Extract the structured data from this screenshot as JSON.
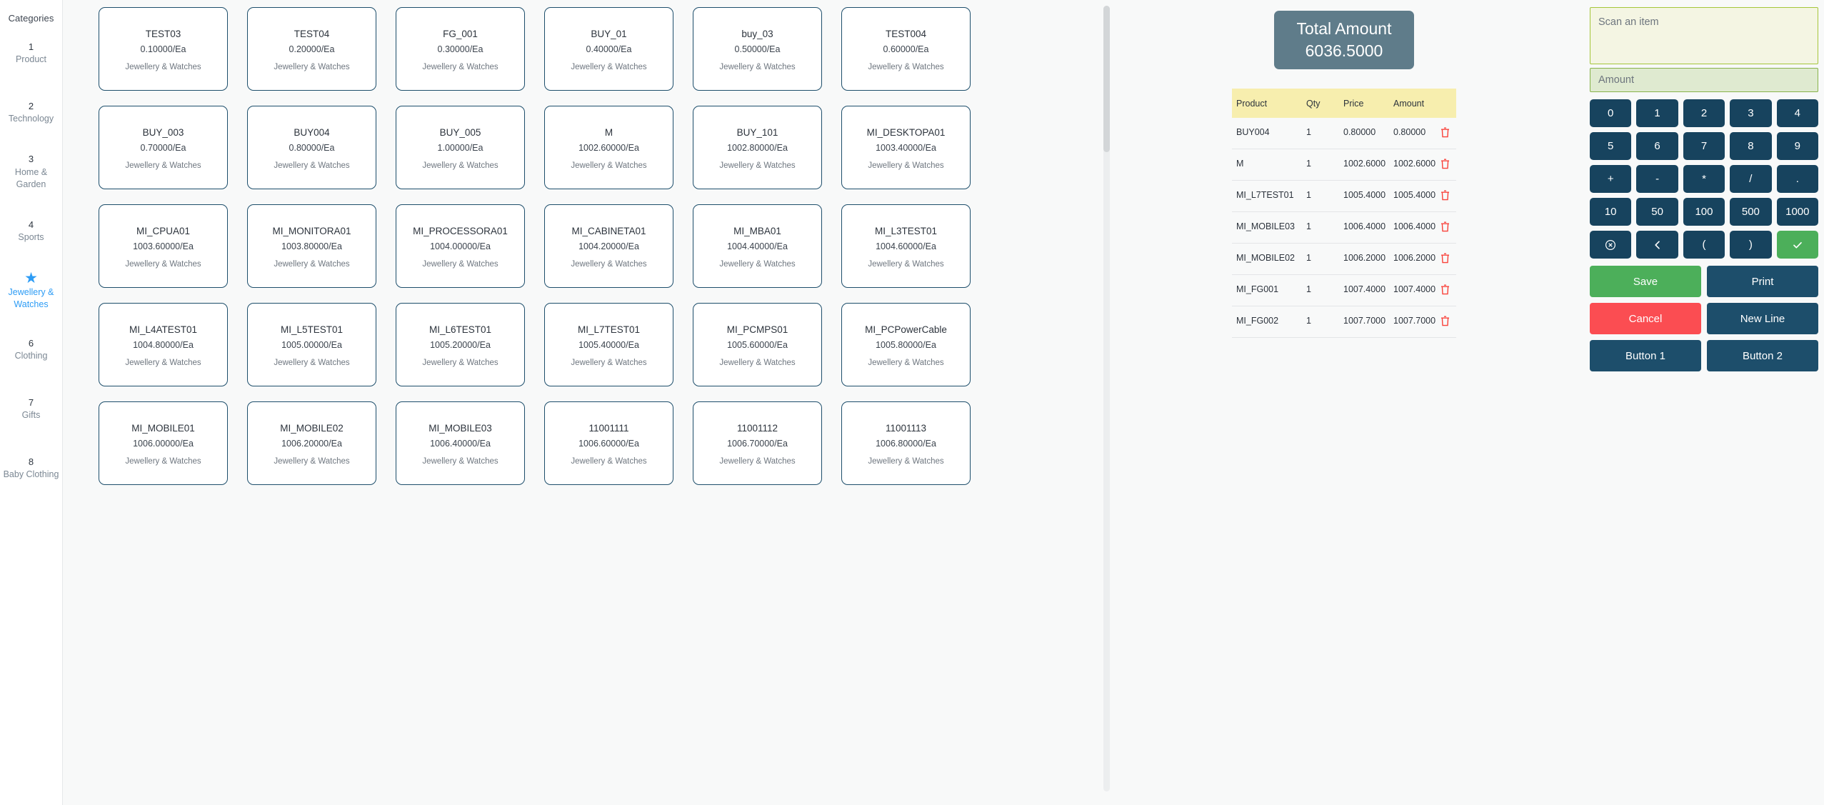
{
  "sidebar": {
    "title": "Categories",
    "items": [
      {
        "num": "1",
        "label": "Product",
        "icon": null,
        "active": false
      },
      {
        "num": "2",
        "label": "Technology",
        "icon": null,
        "active": false
      },
      {
        "num": "3",
        "label": "Home & Garden",
        "icon": null,
        "active": false
      },
      {
        "num": "4",
        "label": "Sports",
        "icon": null,
        "active": false
      },
      {
        "num": "",
        "label": "Jewellery & Watches",
        "icon": "star-icon",
        "active": true
      },
      {
        "num": "6",
        "label": "Clothing",
        "icon": null,
        "active": false
      },
      {
        "num": "7",
        "label": "Gifts",
        "icon": null,
        "active": false
      },
      {
        "num": "8",
        "label": "Baby Clothing",
        "icon": null,
        "active": false
      }
    ]
  },
  "products": [
    {
      "name": "TEST03",
      "price": "0.10000/Ea",
      "category": "Jewellery & Watches"
    },
    {
      "name": "TEST04",
      "price": "0.20000/Ea",
      "category": "Jewellery & Watches"
    },
    {
      "name": "FG_001",
      "price": "0.30000/Ea",
      "category": "Jewellery & Watches"
    },
    {
      "name": "BUY_01",
      "price": "0.40000/Ea",
      "category": "Jewellery & Watches"
    },
    {
      "name": "buy_03",
      "price": "0.50000/Ea",
      "category": "Jewellery & Watches"
    },
    {
      "name": "TEST004",
      "price": "0.60000/Ea",
      "category": "Jewellery & Watches"
    },
    {
      "name": "BUY_003",
      "price": "0.70000/Ea",
      "category": "Jewellery & Watches"
    },
    {
      "name": "BUY004",
      "price": "0.80000/Ea",
      "category": "Jewellery & Watches"
    },
    {
      "name": "BUY_005",
      "price": "1.00000/Ea",
      "category": "Jewellery & Watches"
    },
    {
      "name": "M",
      "price": "1002.60000/Ea",
      "category": "Jewellery & Watches"
    },
    {
      "name": "BUY_101",
      "price": "1002.80000/Ea",
      "category": "Jewellery & Watches"
    },
    {
      "name": "MI_DESKTOPA01",
      "price": "1003.40000/Ea",
      "category": "Jewellery & Watches"
    },
    {
      "name": "MI_CPUA01",
      "price": "1003.60000/Ea",
      "category": "Jewellery & Watches"
    },
    {
      "name": "MI_MONITORA01",
      "price": "1003.80000/Ea",
      "category": "Jewellery & Watches"
    },
    {
      "name": "MI_PROCESSORA01",
      "price": "1004.00000/Ea",
      "category": "Jewellery & Watches"
    },
    {
      "name": "MI_CABINETA01",
      "price": "1004.20000/Ea",
      "category": "Jewellery & Watches"
    },
    {
      "name": "MI_MBA01",
      "price": "1004.40000/Ea",
      "category": "Jewellery & Watches"
    },
    {
      "name": "MI_L3TEST01",
      "price": "1004.60000/Ea",
      "category": "Jewellery & Watches"
    },
    {
      "name": "MI_L4ATEST01",
      "price": "1004.80000/Ea",
      "category": "Jewellery & Watches"
    },
    {
      "name": "MI_L5TEST01",
      "price": "1005.00000/Ea",
      "category": "Jewellery & Watches"
    },
    {
      "name": "MI_L6TEST01",
      "price": "1005.20000/Ea",
      "category": "Jewellery & Watches"
    },
    {
      "name": "MI_L7TEST01",
      "price": "1005.40000/Ea",
      "category": "Jewellery & Watches"
    },
    {
      "name": "MI_PCMPS01",
      "price": "1005.60000/Ea",
      "category": "Jewellery & Watches"
    },
    {
      "name": "MI_PCPowerCable",
      "price": "1005.80000/Ea",
      "category": "Jewellery & Watches"
    },
    {
      "name": "MI_MOBILE01",
      "price": "1006.00000/Ea",
      "category": "Jewellery & Watches"
    },
    {
      "name": "MI_MOBILE02",
      "price": "1006.20000/Ea",
      "category": "Jewellery & Watches"
    },
    {
      "name": "MI_MOBILE03",
      "price": "1006.40000/Ea",
      "category": "Jewellery & Watches"
    },
    {
      "name": "11001111",
      "price": "1006.60000/Ea",
      "category": "Jewellery & Watches"
    },
    {
      "name": "11001112",
      "price": "1006.70000/Ea",
      "category": "Jewellery & Watches"
    },
    {
      "name": "11001113",
      "price": "1006.80000/Ea",
      "category": "Jewellery & Watches"
    }
  ],
  "total": {
    "label": "Total Amount",
    "value": "6036.5000"
  },
  "cart": {
    "columns": [
      "Product",
      "Qty",
      "Price",
      "Amount"
    ],
    "rows": [
      {
        "product": "BUY004",
        "qty": "1",
        "price": "0.80000",
        "amount": "0.80000"
      },
      {
        "product": "M",
        "qty": "1",
        "price": "1002.60000",
        "amount": "1002.60000"
      },
      {
        "product": "MI_L7TEST01",
        "qty": "1",
        "price": "1005.40000",
        "amount": "1005.40000"
      },
      {
        "product": "MI_MOBILE03",
        "qty": "1",
        "price": "1006.40000",
        "amount": "1006.40000"
      },
      {
        "product": "MI_MOBILE02",
        "qty": "1",
        "price": "1006.20000",
        "amount": "1006.20000"
      },
      {
        "product": "MI_FG001",
        "qty": "1",
        "price": "1007.40000",
        "amount": "1007.40000"
      },
      {
        "product": "MI_FG002",
        "qty": "1",
        "price": "1007.70000",
        "amount": "1007.70000"
      }
    ],
    "delete_icon": "trash-icon"
  },
  "scan": {
    "placeholder": "Scan an item",
    "value": ""
  },
  "amount": {
    "placeholder": "Amount",
    "value": ""
  },
  "keypad": {
    "keys": [
      {
        "label": "0",
        "icon": null,
        "style": "dark"
      },
      {
        "label": "1",
        "icon": null,
        "style": "dark"
      },
      {
        "label": "2",
        "icon": null,
        "style": "dark"
      },
      {
        "label": "3",
        "icon": null,
        "style": "dark"
      },
      {
        "label": "4",
        "icon": null,
        "style": "dark"
      },
      {
        "label": "5",
        "icon": null,
        "style": "dark"
      },
      {
        "label": "6",
        "icon": null,
        "style": "dark"
      },
      {
        "label": "7",
        "icon": null,
        "style": "dark"
      },
      {
        "label": "8",
        "icon": null,
        "style": "dark"
      },
      {
        "label": "9",
        "icon": null,
        "style": "dark"
      },
      {
        "label": "+",
        "icon": null,
        "style": "dark"
      },
      {
        "label": "-",
        "icon": null,
        "style": "dark"
      },
      {
        "label": "*",
        "icon": null,
        "style": "dark"
      },
      {
        "label": "/",
        "icon": null,
        "style": "dark"
      },
      {
        "label": ".",
        "icon": null,
        "style": "dark"
      },
      {
        "label": "10",
        "icon": null,
        "style": "dark"
      },
      {
        "label": "50",
        "icon": null,
        "style": "dark"
      },
      {
        "label": "100",
        "icon": null,
        "style": "dark"
      },
      {
        "label": "500",
        "icon": null,
        "style": "dark"
      },
      {
        "label": "1000",
        "icon": null,
        "style": "dark"
      },
      {
        "label": "",
        "icon": "clear-circle-x-icon",
        "style": "dark"
      },
      {
        "label": "",
        "icon": "backspace-chevron-left-icon",
        "style": "dark"
      },
      {
        "label": "(",
        "icon": null,
        "style": "dark"
      },
      {
        "label": ")",
        "icon": null,
        "style": "dark"
      },
      {
        "label": "",
        "icon": "check-icon",
        "style": "green"
      }
    ]
  },
  "actions": [
    {
      "label": "Save",
      "style": "save"
    },
    {
      "label": "Print",
      "style": "dark"
    },
    {
      "label": "Cancel",
      "style": "cancel"
    },
    {
      "label": "New Line",
      "style": "dark"
    },
    {
      "label": "Button 1",
      "style": "dark"
    },
    {
      "label": "Button 2",
      "style": "dark"
    }
  ],
  "colors": {
    "accent_blue": "#2d9cf5",
    "card_border": "#1d4e6b",
    "total_bg": "#5f7c8a",
    "key_dark": "#17435e",
    "green": "#4caf5a",
    "red": "#fb4d52",
    "trash_red": "#f9423a",
    "table_header": "#f7eeae",
    "scan_bg": "#f4f5e3",
    "amount_bg": "#dfead0"
  }
}
